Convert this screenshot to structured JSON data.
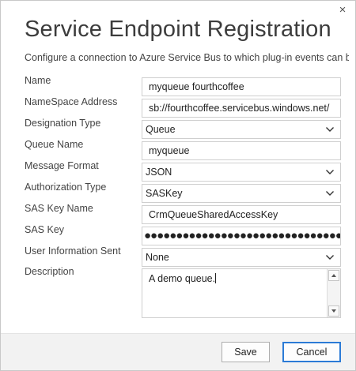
{
  "dialog": {
    "title": "Service Endpoint Registration",
    "subtitle": "Configure a connection to Azure Service Bus to which plug-in events can be",
    "close_glyph": "×"
  },
  "form": {
    "name": {
      "label": "Name",
      "value": "myqueue fourthcoffee"
    },
    "namespace_address": {
      "label": "NameSpace Address",
      "value": "sb://fourthcoffee.servicebus.windows.net/"
    },
    "designation_type": {
      "label": "Designation Type",
      "value": "Queue"
    },
    "queue_name": {
      "label": "Queue Name",
      "value": "myqueue"
    },
    "message_format": {
      "label": "Message Format",
      "value": "JSON"
    },
    "authorization_type": {
      "label": "Authorization Type",
      "value": "SASKey"
    },
    "sas_key_name": {
      "label": "SAS Key Name",
      "value": "CrmQueueSharedAccessKey"
    },
    "sas_key": {
      "label": "SAS Key",
      "masked_value": "●●●●●●●●●●●●●●●●●●●●●●●●●●●●●●●●●●●●●●●●"
    },
    "user_information_sent": {
      "label": "User Information Sent",
      "value": "None"
    },
    "description": {
      "label": "Description",
      "value": "A demo queue."
    }
  },
  "footer": {
    "save_label": "Save",
    "cancel_label": "Cancel"
  },
  "colors": {
    "focus_border": "#2b7bd6",
    "footer_bg": "#f2f2f2"
  }
}
